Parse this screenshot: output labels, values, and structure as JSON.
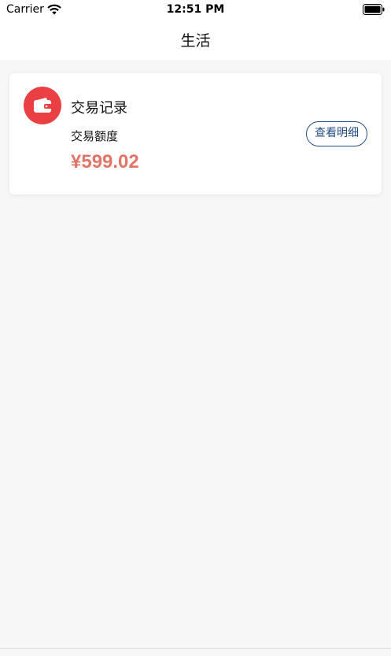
{
  "status_bar": {
    "carrier": "Carrier",
    "time": "12:51 PM"
  },
  "nav": {
    "title": "生活"
  },
  "card": {
    "title": "交易记录",
    "subtitle": "交易额度",
    "amount": "¥599.02",
    "detail_button": "查看明细",
    "icon": "wallet-icon",
    "icon_bg_color": "#ea3f43",
    "amount_color": "#e27468",
    "button_color": "#244f86"
  }
}
